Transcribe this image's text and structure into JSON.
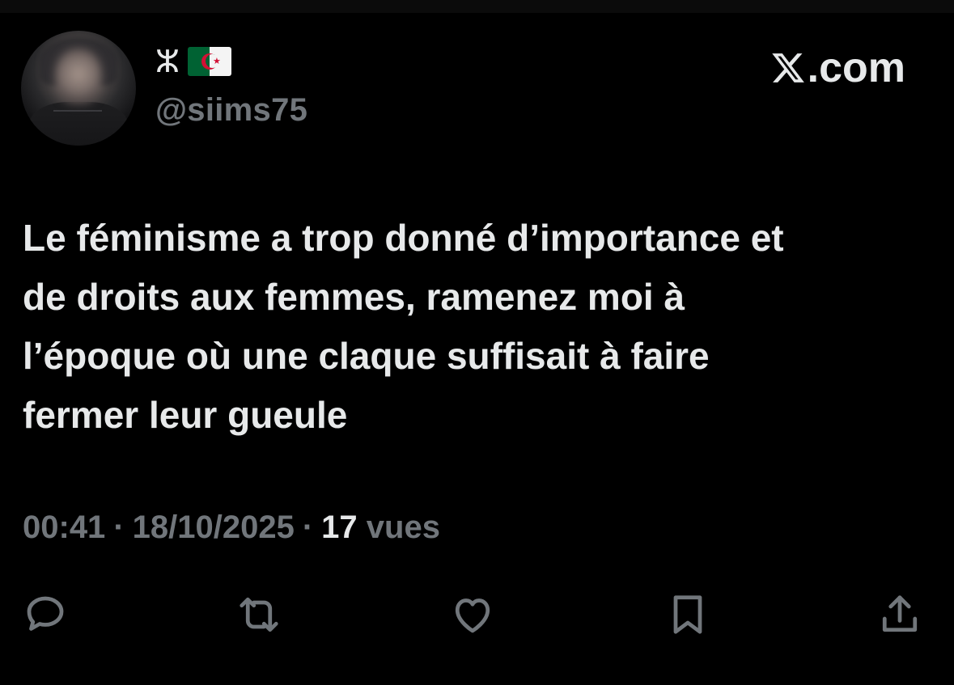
{
  "author": {
    "name_glyph": "ⵣ",
    "flag": "algeria-flag",
    "handle": "@siims75"
  },
  "brand": {
    "domain": ".com",
    "icon": "x-logo-icon"
  },
  "tweet": {
    "text": "Le féminisme a trop donné d’importance et\nde droits aux femmes, ramenez moi à\nl’époque où une claque suffisait à faire\nfermer leur gueule"
  },
  "meta": {
    "time": "00:41",
    "separator": "·",
    "date": "18/10/2025",
    "views_count": "17",
    "views_label": "vues"
  },
  "actions": {
    "reply": "reply-icon",
    "repost": "repost-icon",
    "like": "like-icon",
    "bookmark": "bookmark-icon",
    "share": "share-icon"
  },
  "colors": {
    "background": "#000000",
    "text": "#e7e9ea",
    "secondary": "#71767b"
  }
}
